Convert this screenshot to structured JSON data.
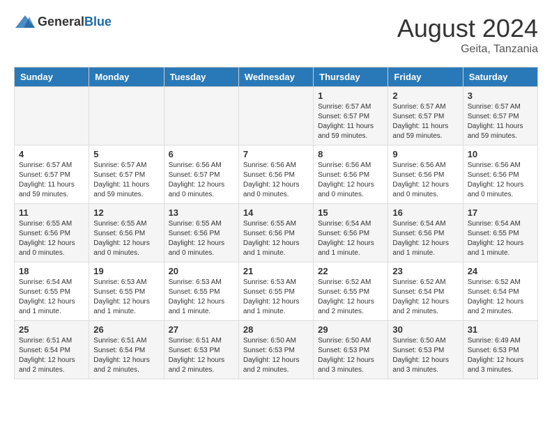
{
  "header": {
    "logo_general": "General",
    "logo_blue": "Blue",
    "month_title": "August 2024",
    "location": "Geita, Tanzania"
  },
  "weekdays": [
    "Sunday",
    "Monday",
    "Tuesday",
    "Wednesday",
    "Thursday",
    "Friday",
    "Saturday"
  ],
  "weeks": [
    [
      {
        "day": "",
        "info": ""
      },
      {
        "day": "",
        "info": ""
      },
      {
        "day": "",
        "info": ""
      },
      {
        "day": "",
        "info": ""
      },
      {
        "day": "1",
        "info": "Sunrise: 6:57 AM\nSunset: 6:57 PM\nDaylight: 11 hours and 59 minutes."
      },
      {
        "day": "2",
        "info": "Sunrise: 6:57 AM\nSunset: 6:57 PM\nDaylight: 11 hours and 59 minutes."
      },
      {
        "day": "3",
        "info": "Sunrise: 6:57 AM\nSunset: 6:57 PM\nDaylight: 11 hours and 59 minutes."
      }
    ],
    [
      {
        "day": "4",
        "info": "Sunrise: 6:57 AM\nSunset: 6:57 PM\nDaylight: 11 hours and 59 minutes."
      },
      {
        "day": "5",
        "info": "Sunrise: 6:57 AM\nSunset: 6:57 PM\nDaylight: 11 hours and 59 minutes."
      },
      {
        "day": "6",
        "info": "Sunrise: 6:56 AM\nSunset: 6:57 PM\nDaylight: 12 hours and 0 minutes."
      },
      {
        "day": "7",
        "info": "Sunrise: 6:56 AM\nSunset: 6:56 PM\nDaylight: 12 hours and 0 minutes."
      },
      {
        "day": "8",
        "info": "Sunrise: 6:56 AM\nSunset: 6:56 PM\nDaylight: 12 hours and 0 minutes."
      },
      {
        "day": "9",
        "info": "Sunrise: 6:56 AM\nSunset: 6:56 PM\nDaylight: 12 hours and 0 minutes."
      },
      {
        "day": "10",
        "info": "Sunrise: 6:56 AM\nSunset: 6:56 PM\nDaylight: 12 hours and 0 minutes."
      }
    ],
    [
      {
        "day": "11",
        "info": "Sunrise: 6:55 AM\nSunset: 6:56 PM\nDaylight: 12 hours and 0 minutes."
      },
      {
        "day": "12",
        "info": "Sunrise: 6:55 AM\nSunset: 6:56 PM\nDaylight: 12 hours and 0 minutes."
      },
      {
        "day": "13",
        "info": "Sunrise: 6:55 AM\nSunset: 6:56 PM\nDaylight: 12 hours and 0 minutes."
      },
      {
        "day": "14",
        "info": "Sunrise: 6:55 AM\nSunset: 6:56 PM\nDaylight: 12 hours and 1 minute."
      },
      {
        "day": "15",
        "info": "Sunrise: 6:54 AM\nSunset: 6:56 PM\nDaylight: 12 hours and 1 minute."
      },
      {
        "day": "16",
        "info": "Sunrise: 6:54 AM\nSunset: 6:56 PM\nDaylight: 12 hours and 1 minute."
      },
      {
        "day": "17",
        "info": "Sunrise: 6:54 AM\nSunset: 6:55 PM\nDaylight: 12 hours and 1 minute."
      }
    ],
    [
      {
        "day": "18",
        "info": "Sunrise: 6:54 AM\nSunset: 6:55 PM\nDaylight: 12 hours and 1 minute."
      },
      {
        "day": "19",
        "info": "Sunrise: 6:53 AM\nSunset: 6:55 PM\nDaylight: 12 hours and 1 minute."
      },
      {
        "day": "20",
        "info": "Sunrise: 6:53 AM\nSunset: 6:55 PM\nDaylight: 12 hours and 1 minute."
      },
      {
        "day": "21",
        "info": "Sunrise: 6:53 AM\nSunset: 6:55 PM\nDaylight: 12 hours and 1 minute."
      },
      {
        "day": "22",
        "info": "Sunrise: 6:52 AM\nSunset: 6:55 PM\nDaylight: 12 hours and 2 minutes."
      },
      {
        "day": "23",
        "info": "Sunrise: 6:52 AM\nSunset: 6:54 PM\nDaylight: 12 hours and 2 minutes."
      },
      {
        "day": "24",
        "info": "Sunrise: 6:52 AM\nSunset: 6:54 PM\nDaylight: 12 hours and 2 minutes."
      }
    ],
    [
      {
        "day": "25",
        "info": "Sunrise: 6:51 AM\nSunset: 6:54 PM\nDaylight: 12 hours and 2 minutes."
      },
      {
        "day": "26",
        "info": "Sunrise: 6:51 AM\nSunset: 6:54 PM\nDaylight: 12 hours and 2 minutes."
      },
      {
        "day": "27",
        "info": "Sunrise: 6:51 AM\nSunset: 6:53 PM\nDaylight: 12 hours and 2 minutes."
      },
      {
        "day": "28",
        "info": "Sunrise: 6:50 AM\nSunset: 6:53 PM\nDaylight: 12 hours and 2 minutes."
      },
      {
        "day": "29",
        "info": "Sunrise: 6:50 AM\nSunset: 6:53 PM\nDaylight: 12 hours and 3 minutes."
      },
      {
        "day": "30",
        "info": "Sunrise: 6:50 AM\nSunset: 6:53 PM\nDaylight: 12 hours and 3 minutes."
      },
      {
        "day": "31",
        "info": "Sunrise: 6:49 AM\nSunset: 6:53 PM\nDaylight: 12 hours and 3 minutes."
      }
    ]
  ]
}
